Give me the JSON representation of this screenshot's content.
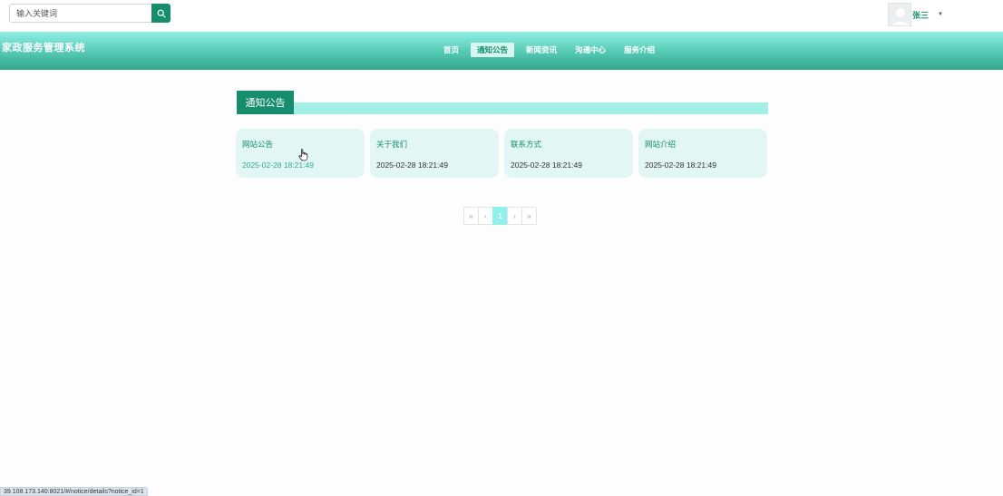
{
  "search": {
    "placeholder": "输入关键词",
    "icon": "search-icon"
  },
  "user": {
    "name": "张三",
    "avatar_icon": "avatar-icon",
    "caret_icon": "caret-down-icon"
  },
  "header": {
    "title": "家政服务管理系统"
  },
  "nav": {
    "items": [
      {
        "label": "首页"
      },
      {
        "label": "通知公告",
        "active": true
      },
      {
        "label": "新闻资讯"
      },
      {
        "label": "沟通中心"
      },
      {
        "label": "服务介绍"
      }
    ]
  },
  "section": {
    "title": "通知公告"
  },
  "notices": [
    {
      "title": "网站公告",
      "date": "2025-02-28 18:21:49"
    },
    {
      "title": "关于我们",
      "date": "2025-02-28 18:21:49"
    },
    {
      "title": "联系方式",
      "date": "2025-02-28 18:21:49"
    },
    {
      "title": "网站介绍",
      "date": "2025-02-28 18:21:49"
    }
  ],
  "pagination": {
    "first": "«",
    "prev": "‹",
    "current": "1",
    "next": "›",
    "last": "»"
  },
  "statusbar": {
    "url": "39.108.173.140:8021/#/notice/details?notice_id=1"
  },
  "colors": {
    "primary": "#168e6e",
    "accent_light": "#a2efe6",
    "card_bg": "#e2f6f3",
    "page_current": "#8ff0ec"
  }
}
